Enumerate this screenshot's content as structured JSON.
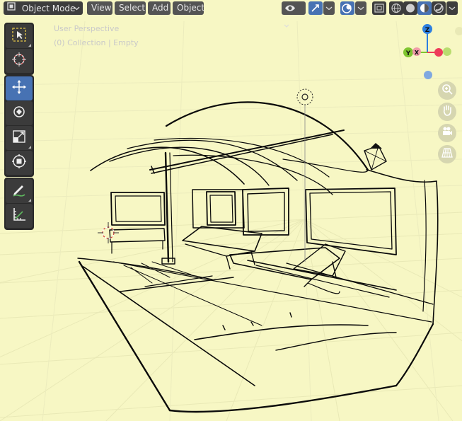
{
  "header": {
    "mode_label": "Object Mode",
    "menus": [
      {
        "label": "View"
      },
      {
        "label": "Select"
      },
      {
        "label": "Add"
      },
      {
        "label": "Object"
      }
    ]
  },
  "viewport": {
    "perspective_label": "User Perspective",
    "collection_label": "(0) Collection | Empty"
  },
  "gizmo": {
    "axis_z": "Z",
    "axis_y": "Y",
    "axis_x": "X",
    "colors": {
      "x": "#ee3c5a",
      "y": "#7ec42f",
      "z": "#2d7fe0"
    }
  },
  "colors": {
    "background": "#f7f7c4",
    "accent": "#4772b3",
    "header_button": "#545454",
    "toolbar": "#2a2a2a"
  },
  "icons": {
    "toolbar": [
      "select-box-icon",
      "cursor-icon",
      "move-icon",
      "rotate-icon",
      "scale-icon",
      "transform-icon",
      "annotate-icon",
      "measure-icon"
    ],
    "nav": [
      "zoom-icon",
      "pan-hand-icon",
      "camera-icon",
      "grid-ortho-icon"
    ]
  }
}
